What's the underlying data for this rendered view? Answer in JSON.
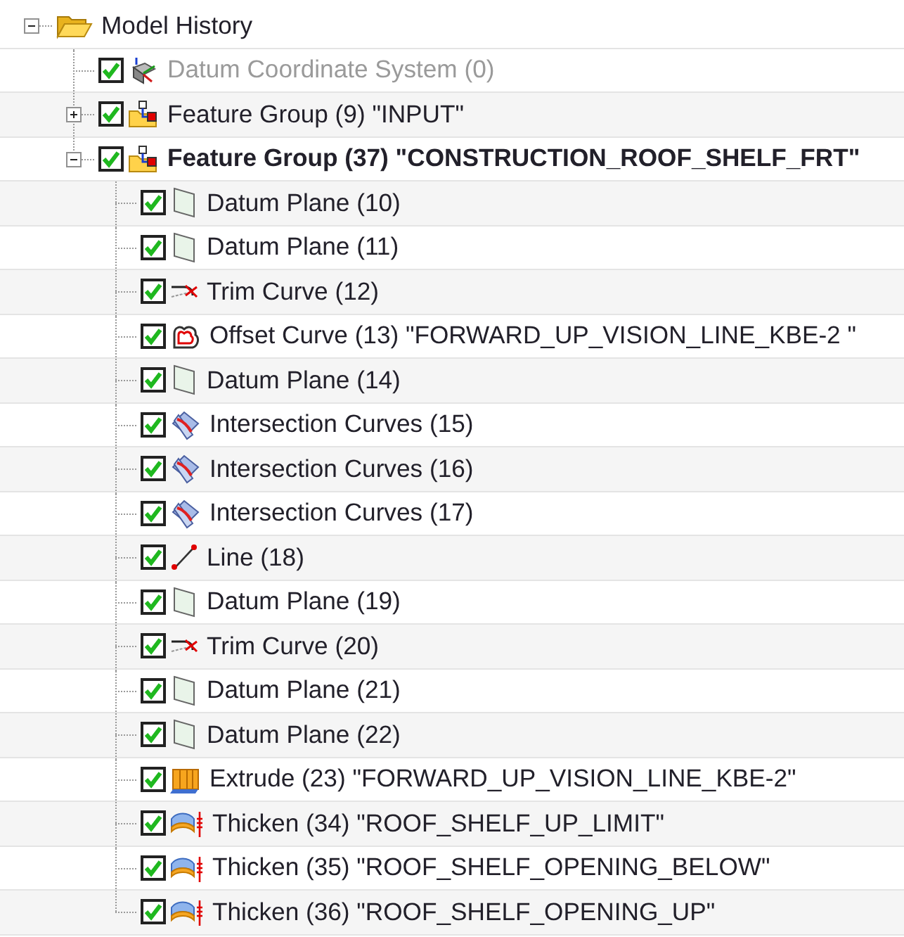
{
  "tree": [
    {
      "label": "Model History",
      "kind": "folder",
      "expanded": true,
      "dimmed": false,
      "current": false,
      "children": [
        {
          "label": "Datum Coordinate System (0)",
          "kind": "datum_csys",
          "checked": true,
          "dimmed": true,
          "current": false
        },
        {
          "label": "Feature Group (9) \"INPUT\"",
          "kind": "feature_group",
          "checked": true,
          "expanded": false,
          "dimmed": false,
          "current": false
        },
        {
          "label": "Feature Group (37) \"CONSTRUCTION_ROOF_SHELF_FRT\"",
          "kind": "feature_group",
          "checked": true,
          "expanded": true,
          "dimmed": false,
          "current": true,
          "children": [
            {
              "label": "Datum Plane (10)",
              "kind": "datum_plane",
              "checked": true,
              "dimmed": false,
              "current": false
            },
            {
              "label": "Datum Plane (11)",
              "kind": "datum_plane",
              "checked": true,
              "dimmed": false,
              "current": false
            },
            {
              "label": "Trim Curve (12)",
              "kind": "trim_curve",
              "checked": true,
              "dimmed": false,
              "current": false
            },
            {
              "label": "Offset Curve (13) \"FORWARD_UP_VISION_LINE_KBE-2 \"",
              "kind": "offset_curve",
              "checked": true,
              "dimmed": false,
              "current": false
            },
            {
              "label": "Datum Plane (14)",
              "kind": "datum_plane",
              "checked": true,
              "dimmed": false,
              "current": false
            },
            {
              "label": "Intersection Curves (15)",
              "kind": "intersection_curves",
              "checked": true,
              "dimmed": false,
              "current": false
            },
            {
              "label": "Intersection Curves (16)",
              "kind": "intersection_curves",
              "checked": true,
              "dimmed": false,
              "current": false
            },
            {
              "label": "Intersection Curves (17)",
              "kind": "intersection_curves",
              "checked": true,
              "dimmed": false,
              "current": false
            },
            {
              "label": "Line (18)",
              "kind": "line",
              "checked": true,
              "dimmed": false,
              "current": false
            },
            {
              "label": "Datum Plane (19)",
              "kind": "datum_plane",
              "checked": true,
              "dimmed": false,
              "current": false
            },
            {
              "label": "Trim Curve (20)",
              "kind": "trim_curve",
              "checked": true,
              "dimmed": false,
              "current": false
            },
            {
              "label": "Datum Plane (21)",
              "kind": "datum_plane",
              "checked": true,
              "dimmed": false,
              "current": false
            },
            {
              "label": "Datum Plane (22)",
              "kind": "datum_plane",
              "checked": true,
              "dimmed": false,
              "current": false
            },
            {
              "label": "Extrude (23) \"FORWARD_UP_VISION_LINE_KBE-2\"",
              "kind": "extrude",
              "checked": true,
              "dimmed": false,
              "current": false
            },
            {
              "label": "Thicken (34) \"ROOF_SHELF_UP_LIMIT\"",
              "kind": "thicken",
              "checked": true,
              "dimmed": false,
              "current": false
            },
            {
              "label": "Thicken (35) \"ROOF_SHELF_OPENING_BELOW\"",
              "kind": "thicken",
              "checked": true,
              "dimmed": false,
              "current": false
            },
            {
              "label": "Thicken (36) \"ROOF_SHELF_OPENING_UP\"",
              "kind": "thicken",
              "checked": true,
              "dimmed": false,
              "current": false
            }
          ]
        }
      ]
    }
  ]
}
